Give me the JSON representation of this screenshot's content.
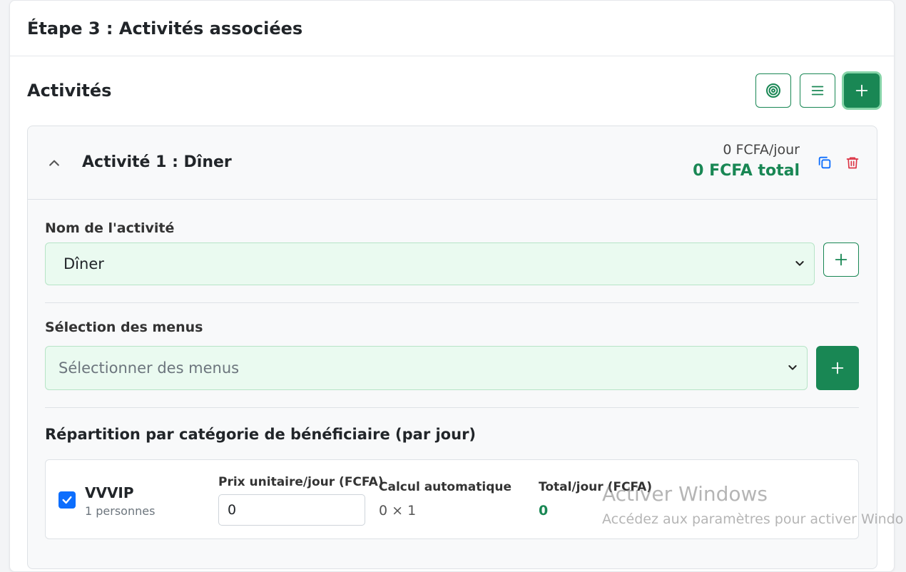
{
  "step": {
    "title": "Étape 3 : Activités associées"
  },
  "section": {
    "title": "Activités"
  },
  "activity": {
    "title": "Activité 1 : Dîner",
    "per_day": "0 FCFA/jour",
    "total": "0 FCFA total",
    "name_label": "Nom de l'activité",
    "name_value": "Dîner",
    "menus_label": "Sélection des menus",
    "menus_placeholder": "Sélectionner des menus",
    "repartition_title": "Répartition par catégorie de bénéficiaire (par jour)"
  },
  "beneficiary": {
    "name": "VVVIP",
    "count": "1 personnes",
    "price_label": "Prix unitaire/jour (FCFA)",
    "price_value": "0",
    "calc_label": "Calcul automatique",
    "calc_value": "0 × 1",
    "total_label": "Total/jour (FCFA)",
    "total_value": "0",
    "checked": true
  },
  "watermark": {
    "title": "Activer Windows",
    "subtitle": "Accédez aux paramètres pour activer Windo"
  },
  "colors": {
    "accent": "#198754",
    "danger": "#dc3545",
    "info": "#0d6efd",
    "field_bg": "#eafaf0"
  },
  "icons": [
    "target-icon",
    "list-icon",
    "plus-icon",
    "chevron-up-icon",
    "copy-icon",
    "trash-icon",
    "chevron-down-icon",
    "check-icon"
  ]
}
